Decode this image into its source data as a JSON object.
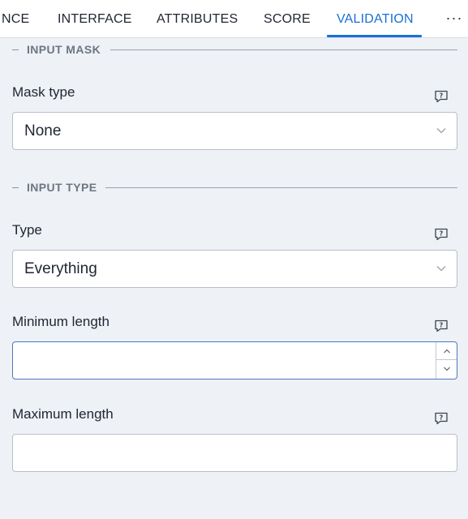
{
  "tabs": [
    {
      "label": "NCE",
      "active": false
    },
    {
      "label": "INTERFACE",
      "active": false
    },
    {
      "label": "ATTRIBUTES",
      "active": false
    },
    {
      "label": "SCORE",
      "active": false
    },
    {
      "label": "VALIDATION",
      "active": true
    }
  ],
  "more_label": "···",
  "sections": {
    "input_mask": {
      "title": "INPUT MASK",
      "mask_type": {
        "label": "Mask type",
        "value": "None",
        "help_icon": "help-question-icon"
      }
    },
    "input_type": {
      "title": "INPUT TYPE",
      "type": {
        "label": "Type",
        "value": "Everything",
        "help_icon": "help-question-icon"
      },
      "min_length": {
        "label": "Minimum length",
        "value": "",
        "help_icon": "help-question-icon"
      },
      "max_length": {
        "label": "Maximum length",
        "value": "",
        "help_icon": "help-question-icon"
      }
    }
  },
  "colors": {
    "accent": "#1a6fd6",
    "background": "#eef1f5",
    "border": "#b9bfc8"
  }
}
